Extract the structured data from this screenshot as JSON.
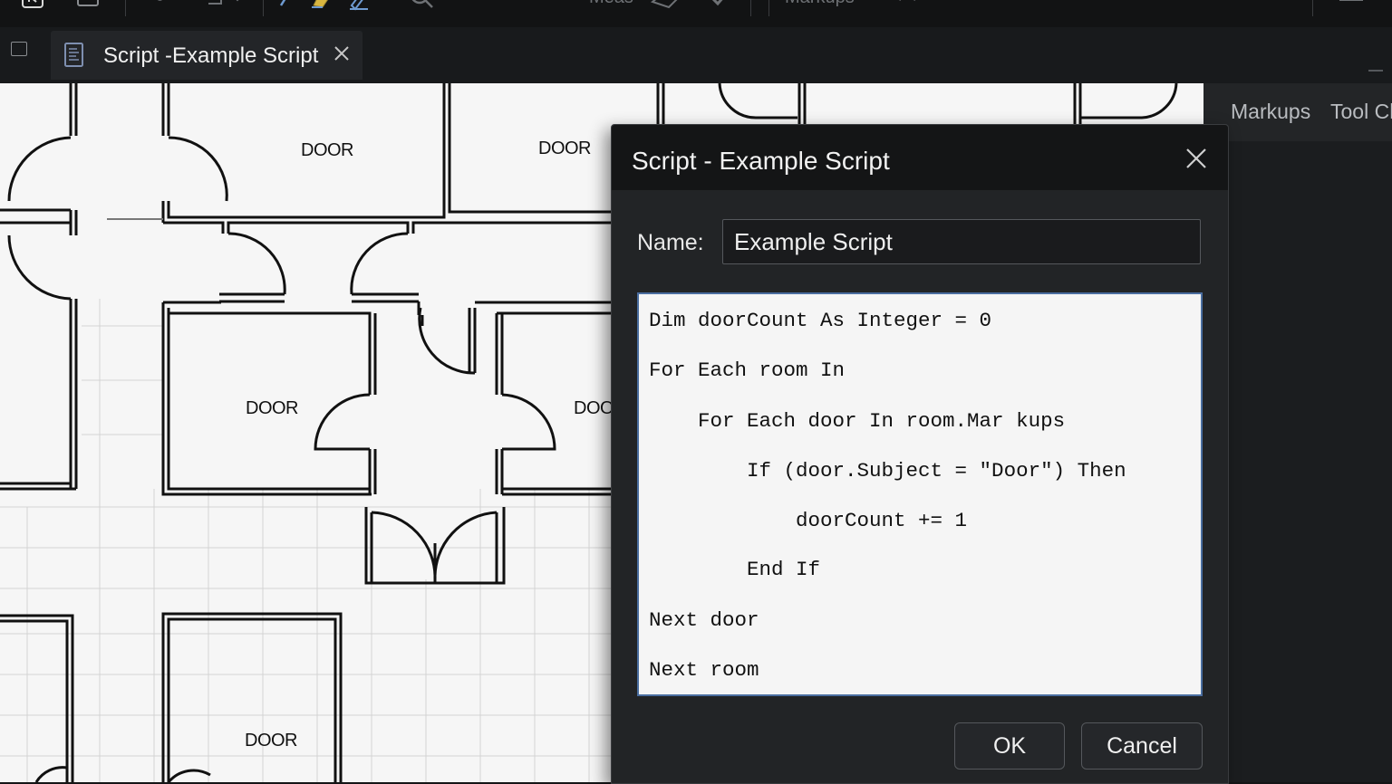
{
  "toolbar": {
    "measure_label": "Meas",
    "markups_label": "Markups",
    "icons": [
      "app-logo-icon",
      "save-icon",
      "undo-icon",
      "crop-icon",
      "pen-icon",
      "highlighter-icon",
      "edit-icon",
      "search-icon",
      "measure-icon",
      "check-icon",
      "link-icon",
      "menu-icon"
    ]
  },
  "tab": {
    "title": "Script -Example Script",
    "icon": "document-icon"
  },
  "canvas": {
    "door_labels": [
      "DOOR",
      "DOOR",
      "DOOR",
      "DOO",
      "DOOR"
    ]
  },
  "side_panel": {
    "tabs": [
      "Markups",
      "Tool Ch"
    ]
  },
  "dialog": {
    "title": "Script - Example Script",
    "name_label": "Name:",
    "name_value": "Example Script",
    "code_lines": [
      "Dim doorCount As Integer = 0",
      "For Each room In",
      "    For Each door In room.Mar kups",
      "        If (door.Subject = \"Door\") Then",
      "            doorCount += 1",
      "        End If",
      "Next door",
      "Next room"
    ],
    "ok_label": "OK",
    "cancel_label": "Cancel"
  }
}
